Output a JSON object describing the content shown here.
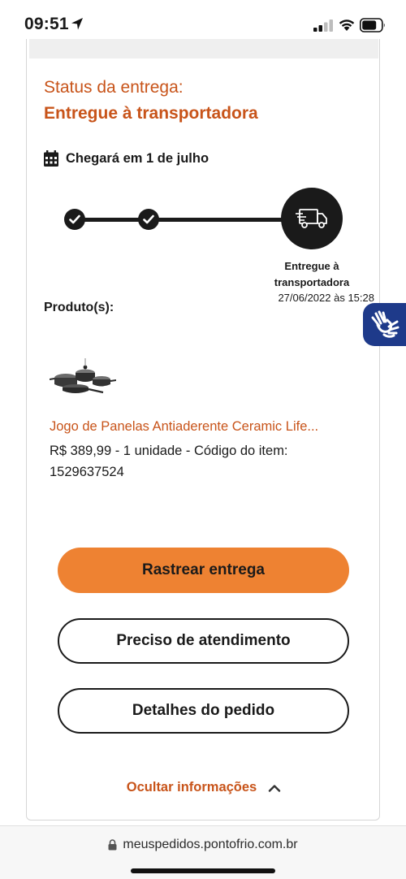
{
  "status_bar": {
    "time": "09:51"
  },
  "delivery": {
    "status_label": "Status da entrega:",
    "status_value": "Entregue à transportadora",
    "eta": "Chegará em 1 de julho",
    "current_step": {
      "label": "Entregue à transportadora",
      "date": "27/06/2022 às 15:28"
    }
  },
  "product": {
    "heading": "Produto(s):",
    "name": "Jogo de Panelas Antiaderente Ceramic Life...",
    "details": "R$ 389,99 - 1 unidade - Código do item: 1529637524"
  },
  "actions": {
    "track": "Rastrear entrega",
    "support": "Preciso de atendimento",
    "order_details": "Detalhes do pedido",
    "hide_info": "Ocultar informações"
  },
  "browser": {
    "url": "meuspedidos.pontofrio.com.br"
  },
  "colors": {
    "accent_text": "#c8541a",
    "primary_button": "#ee8232",
    "a11y_tab": "#1e3a8a"
  },
  "icons": [
    "location-arrow-icon",
    "signal-icon",
    "wifi-icon",
    "battery-icon",
    "calendar-icon",
    "check-icon",
    "truck-icon",
    "chevron-up-icon",
    "sign-language-icon",
    "lock-icon"
  ]
}
